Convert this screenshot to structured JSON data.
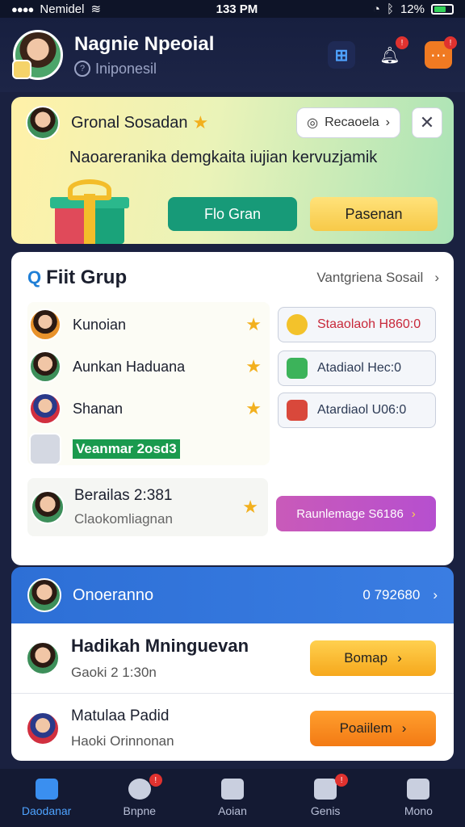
{
  "status_bar": {
    "carrier": "Nemidel",
    "time": "133 PM",
    "battery": "12%"
  },
  "header": {
    "title": "Nagnie Npeoial",
    "subtitle": "Iniponesil",
    "badge_bell": "!",
    "badge_chat": "!"
  },
  "promo": {
    "name": "Gronal Sosadan",
    "pill_label": "Recaoela",
    "message": "Naoareranika demgkaita iujian kervuzjamik",
    "button_green": "Flo Gran",
    "button_yellow": "Pasenan"
  },
  "group": {
    "title": "Fiit Grup",
    "link": "Vantgriena Sosail",
    "members": [
      {
        "name": "Kunoian"
      },
      {
        "name": "Aunkan Haduana"
      },
      {
        "name": "Shanan"
      }
    ],
    "badge_label": "Veanmar 2osd3",
    "actions": [
      {
        "label": "Staaolaoh H860:0"
      },
      {
        "label": "Atadiaol Hec:0"
      },
      {
        "label": "Atardiaol U06:0"
      }
    ],
    "feature": {
      "title": "Berailas 2:381",
      "subtitle": "Claokomliagnan"
    },
    "purple_button": "Raunlemage S6186"
  },
  "blue_bar": {
    "title": "Onoeranno",
    "number": "0 792680"
  },
  "list": [
    {
      "title": "Hadikah Mninguevan",
      "sub": "Gaoki 2 1:30n",
      "button": "Bomap"
    },
    {
      "title": "Matulaa Padid",
      "sub": "Haoki Orinnonan",
      "button": "Poaiilem"
    }
  ],
  "nav": [
    {
      "label": "Daodanar",
      "active": true
    },
    {
      "label": "Bnpne",
      "badge": "!"
    },
    {
      "label": "Aoian"
    },
    {
      "label": "Genis",
      "badge": "!"
    },
    {
      "label": "Mono"
    }
  ]
}
